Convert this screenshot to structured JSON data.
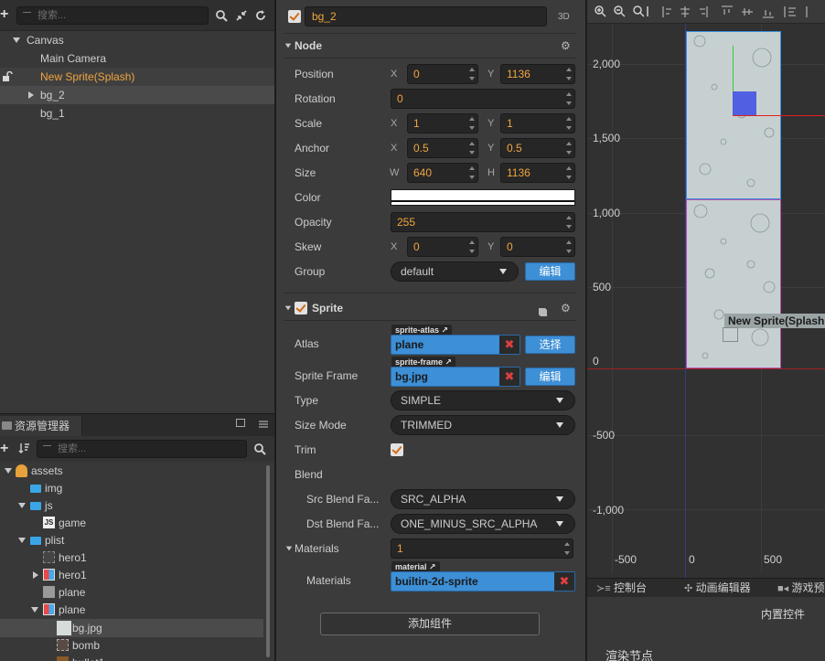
{
  "hierarchy": {
    "search_placeholder": "搜索...",
    "items": [
      {
        "label": "Canvas"
      },
      {
        "label": "Main Camera"
      },
      {
        "label": "New Sprite(Splash)"
      },
      {
        "label": "bg_2"
      },
      {
        "label": "bg_1"
      }
    ]
  },
  "assets": {
    "tab_label": "资源管理器",
    "search_placeholder": "搜索...",
    "items": [
      {
        "label": "assets"
      },
      {
        "label": "img"
      },
      {
        "label": "js"
      },
      {
        "label": "game"
      },
      {
        "label": "plist"
      },
      {
        "label": "hero1"
      },
      {
        "label": "hero1"
      },
      {
        "label": "plane"
      },
      {
        "label": "plane"
      },
      {
        "label": "bg.jpg"
      },
      {
        "label": "bomb"
      },
      {
        "label": "bullet1"
      }
    ]
  },
  "inspector": {
    "node_name": "bg_2",
    "mode_3d": "3D",
    "node_section": "Node",
    "position": {
      "label": "Position",
      "x": "0",
      "y": "1136"
    },
    "rotation": {
      "label": "Rotation",
      "value": "0"
    },
    "scale": {
      "label": "Scale",
      "x": "1",
      "y": "1"
    },
    "anchor": {
      "label": "Anchor",
      "x": "0.5",
      "y": "0.5"
    },
    "size": {
      "label": "Size",
      "w": "640",
      "h": "1136"
    },
    "color": {
      "label": "Color",
      "value": "#ffffff"
    },
    "opacity": {
      "label": "Opacity",
      "value": "255"
    },
    "skew": {
      "label": "Skew",
      "x": "0",
      "y": "0"
    },
    "group": {
      "label": "Group",
      "value": "default",
      "edit": "编辑"
    },
    "axis": {
      "x": "X",
      "y": "Y",
      "w": "W",
      "h": "H"
    },
    "sprite_section": "Sprite",
    "atlas": {
      "label": "Atlas",
      "tag": "sprite-atlas",
      "value": "plane",
      "button": "选择"
    },
    "sprite_frame": {
      "label": "Sprite Frame",
      "tag": "sprite-frame",
      "value": "bg.jpg",
      "button": "编辑"
    },
    "type": {
      "label": "Type",
      "value": "SIMPLE"
    },
    "size_mode": {
      "label": "Size Mode",
      "value": "TRIMMED"
    },
    "trim": {
      "label": "Trim"
    },
    "blend": {
      "label": "Blend"
    },
    "src_blend": {
      "label": "Src Blend Fa...",
      "value": "SRC_ALPHA"
    },
    "dst_blend": {
      "label": "Dst Blend Fa...",
      "value": "ONE_MINUS_SRC_ALPHA"
    },
    "materials_header": {
      "label": "Materials",
      "value": "1"
    },
    "material": {
      "label": "Materials",
      "tag": "material",
      "value": "builtin-2d-sprite"
    },
    "add_component": "添加组件"
  },
  "scene": {
    "y_labels": [
      "2,000",
      "1,500",
      "1,000",
      "500",
      "0",
      "-500",
      "-1,000"
    ],
    "x_labels": [
      "-500",
      "0",
      "500"
    ],
    "sprite_label": "New Sprite(Splash"
  },
  "bottom": {
    "tabs": [
      "控制台",
      "动画编辑器",
      "游戏预"
    ],
    "builtin_controls": "内置控件",
    "render_node": "渲染节点"
  },
  "colors": {
    "accent": "#f0a540",
    "selection_blue": "#3d8fd6",
    "scene_bg": "#313131"
  }
}
